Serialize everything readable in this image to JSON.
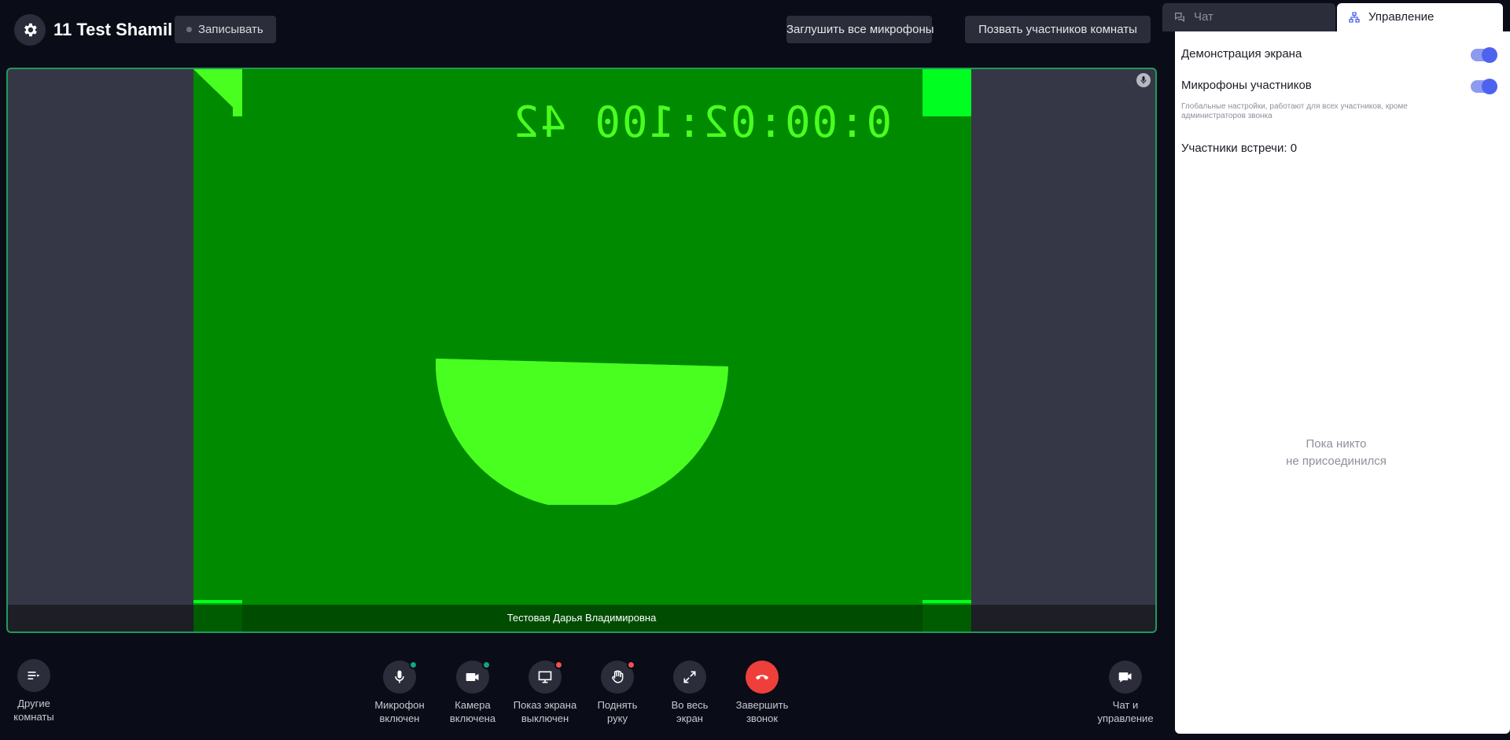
{
  "header": {
    "room_title": "11 Test Shamil",
    "record_label": "Записывать",
    "mute_all_label": "Заглушить все микрофоны",
    "call_participants_label": "Позвать участников комнаты"
  },
  "video": {
    "timer_text": "0:00:02:100 42",
    "participant_name": "Тестовая Дарья Владимировна"
  },
  "toolbar": {
    "other_rooms": "Другие\nкомнаты",
    "mic": "Микрофон\nвключен",
    "camera": "Камера\nвключена",
    "screen": "Показ экрана\nвыключен",
    "hand": "Поднять\nруку",
    "fullscreen": "Во весь\nэкран",
    "end_call": "Завершить\nзвонок",
    "chat_manage": "Чат и\nуправление"
  },
  "panel": {
    "tab_chat": "Чат",
    "tab_manage": "Управление",
    "screen_share_label": "Демонстрация экрана",
    "participant_mics_label": "Микрофоны участников",
    "hint": "Глобальные настройки, работают для всех участников, кроме администраторов звонка",
    "participants_count": "Участники встречи: 0",
    "empty_text": "Пока никто\nне присоединился"
  },
  "colors": {
    "accent": "#4d63f0",
    "end_call": "#ef3f3a",
    "status_on": "#0fa586",
    "status_off": "#ef5350",
    "active_border": "#1f9a5c"
  }
}
